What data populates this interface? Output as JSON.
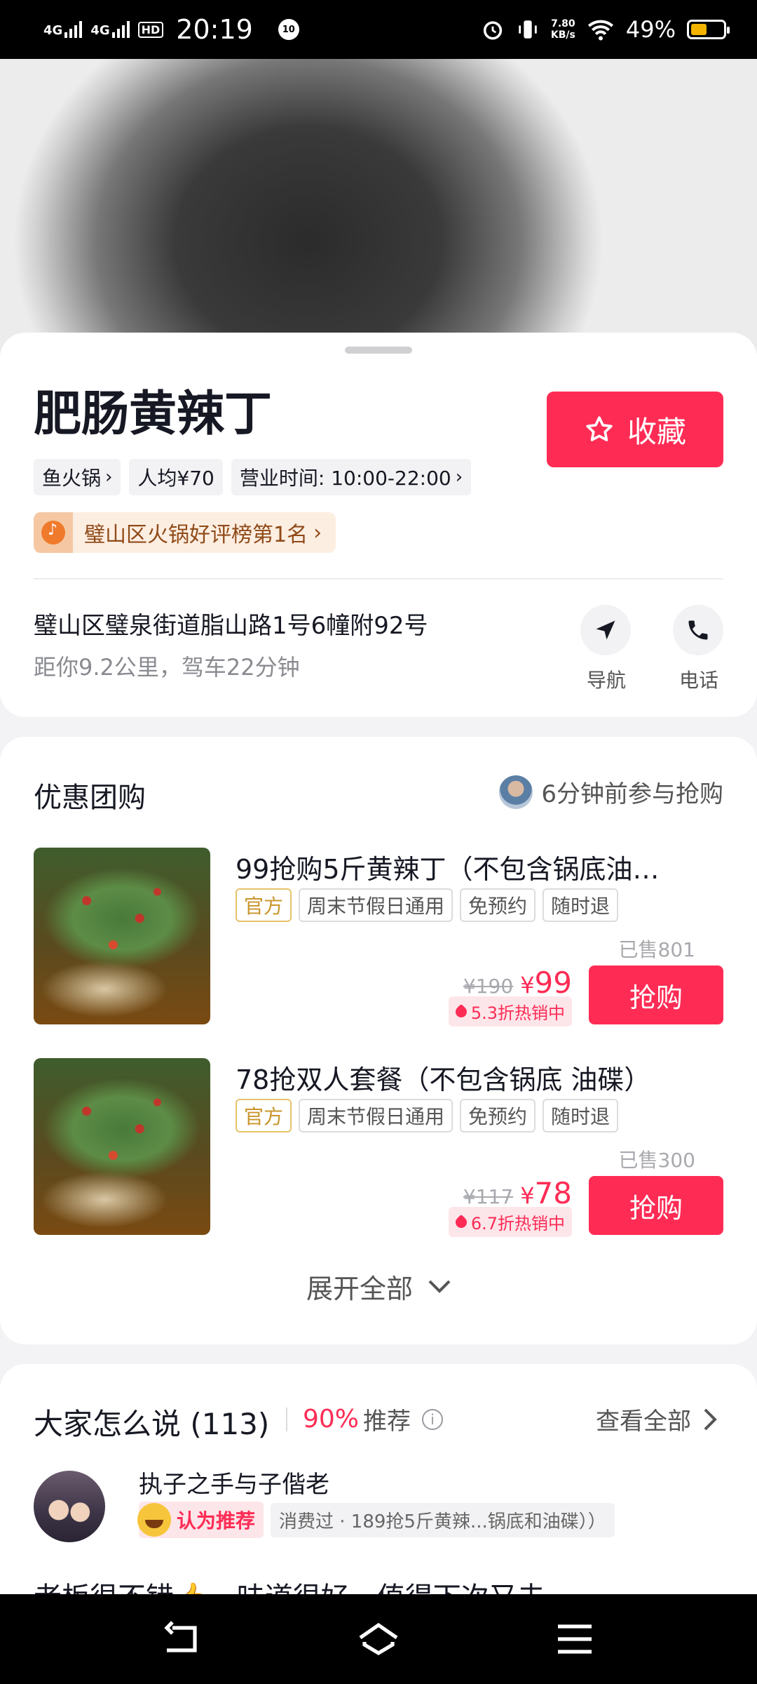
{
  "status_bar": {
    "network1": "4G",
    "network2": "4G",
    "hd": "HD",
    "time": "20:19",
    "notif_badge": "10",
    "speed_value": "7.80",
    "speed_unit": "KB/s",
    "battery_pct": "49%",
    "battery_level": 0.49,
    "icons": [
      "alarm-icon",
      "vibrate-icon",
      "wifi-icon"
    ]
  },
  "shop": {
    "name": "肥肠黄辣丁",
    "favorite_label": "收藏",
    "tags": [
      "鱼火锅",
      "人均¥70",
      "营业时间: 10:00-22:00"
    ],
    "rank": "璧山区火锅好评榜第1名",
    "address": "璧山区璧泉街道脂山路1号6幢附92号",
    "distance": "距你9.2公里，驾车22分钟",
    "nav_label": "导航",
    "call_label": "电话"
  },
  "deals": {
    "title": "优惠团购",
    "join_text": "6分钟前参与抢购",
    "items": [
      {
        "title": "99抢购5斤黄辣丁（不包含锅底油…",
        "tags": [
          "官方",
          "周末节假日通用",
          "免预约",
          "随时退"
        ],
        "sold": "已售801",
        "old_price": "¥190",
        "price_symbol": "¥",
        "price": "99",
        "discount": "5.3折热销中",
        "buy_label": "抢购"
      },
      {
        "title": "78抢双人套餐（不包含锅底 油碟）",
        "tags": [
          "官方",
          "周末节假日通用",
          "免预约",
          "随时退"
        ],
        "sold": "已售300",
        "old_price": "¥117",
        "price_symbol": "¥",
        "price": "78",
        "discount": "6.7折热销中",
        "buy_label": "抢购"
      }
    ],
    "expand_label": "展开全部"
  },
  "reviews": {
    "title": "大家怎么说 (113)",
    "percent": "90%",
    "recommend_suffix": "推荐",
    "info_glyph": "i",
    "see_all": "查看全部",
    "reviewer": {
      "name": "执子之手与子偕老",
      "badge": "认为推荐",
      "consumed": "消费过 · 189抢5斤黄辣...锅底和油碟））",
      "text": "老板很不错👍，味道很好，值得下次又去"
    }
  },
  "colors": {
    "accent": "#fe2c55",
    "official": "#c9952a",
    "rank_text": "#8f4a18"
  }
}
